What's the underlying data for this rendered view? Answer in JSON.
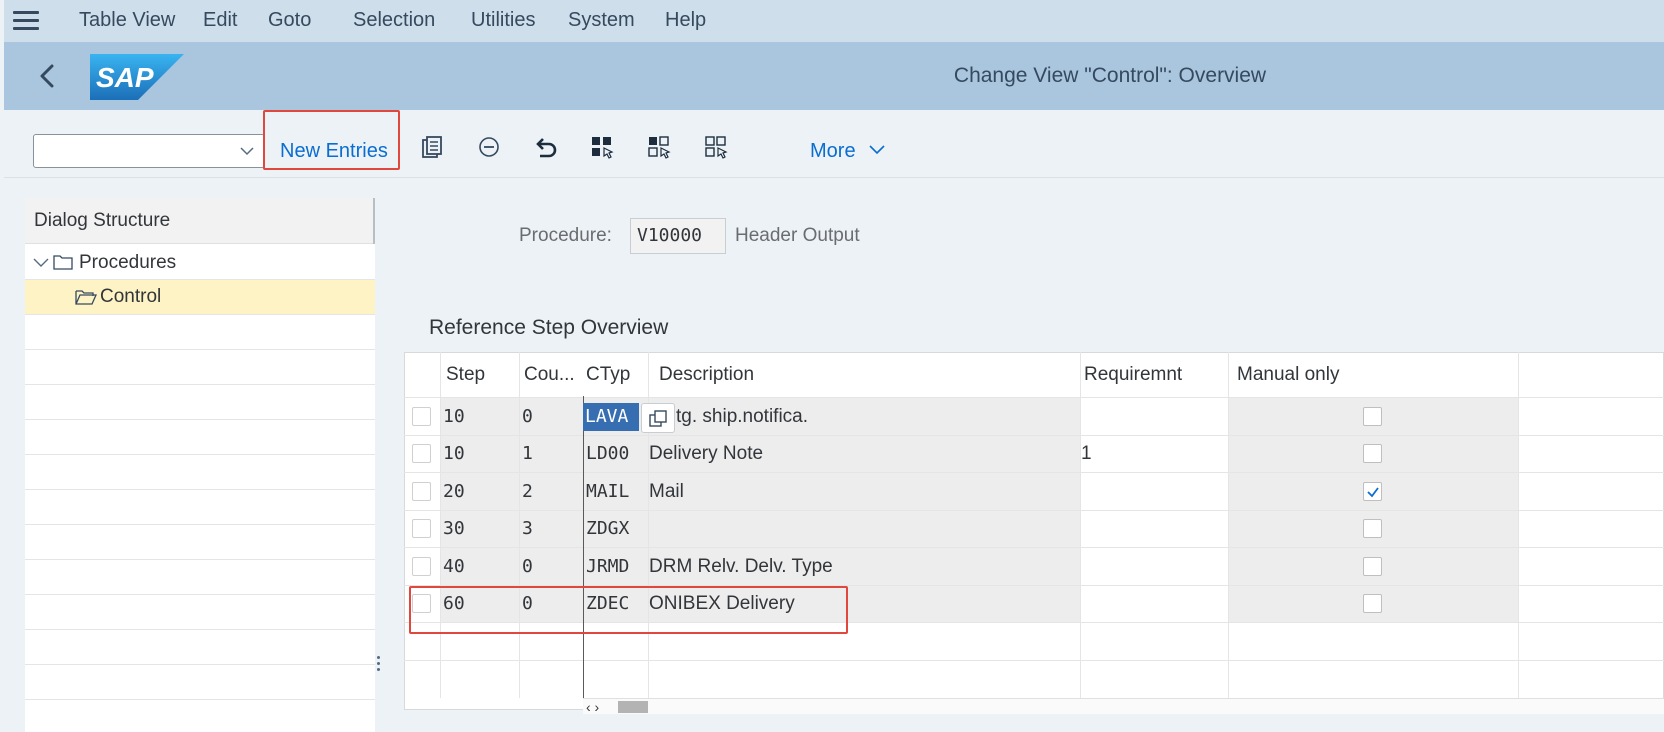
{
  "menu": {
    "items": [
      "Table View",
      "Edit",
      "Goto",
      "Selection",
      "Utilities",
      "System",
      "Help"
    ]
  },
  "header": {
    "title": "Change View \"Control\": Overview",
    "logo_text": "SAP"
  },
  "toolbar": {
    "select_value": "",
    "new_entries_label": "New Entries",
    "more_label": "More"
  },
  "dialog_structure": {
    "title": "Dialog Structure",
    "items": [
      {
        "label": "Procedures",
        "expanded": true,
        "icon": "folder-icon"
      },
      {
        "label": "Control",
        "selected": true,
        "icon": "folder-open-icon"
      }
    ]
  },
  "procedure": {
    "label": "Procedure:",
    "value": "V10000",
    "description": "Header Output"
  },
  "table": {
    "title": "Reference Step Overview",
    "columns": [
      "Step",
      "Cou...",
      "CTyp",
      "Description",
      "Requiremnt",
      "Manual only"
    ],
    "rows": [
      {
        "step": "10",
        "counter": "0",
        "ctyp": "LAVA",
        "description": "tg. ship.notifica.",
        "requirement": "",
        "manual_only": false
      },
      {
        "step": "10",
        "counter": "1",
        "ctyp": "LD00",
        "description": "Delivery Note",
        "requirement": "1",
        "manual_only": false
      },
      {
        "step": "20",
        "counter": "2",
        "ctyp": "MAIL",
        "description": "Mail",
        "requirement": "",
        "manual_only": true
      },
      {
        "step": "30",
        "counter": "3",
        "ctyp": "ZDGX",
        "description": "",
        "requirement": "",
        "manual_only": false
      },
      {
        "step": "40",
        "counter": "0",
        "ctyp": "JRMD",
        "description": "DRM Relv. Delv. Type",
        "requirement": "",
        "manual_only": false
      },
      {
        "step": "60",
        "counter": "0",
        "ctyp": "ZDEC",
        "description": "ONIBEX Delivery",
        "requirement": "",
        "manual_only": false
      }
    ],
    "scroll_arrows": "‹ ›"
  },
  "colors": {
    "menubar_bg": "#cfdeeb",
    "header_bg": "#a9c6de",
    "accent": "#0a6ed1",
    "highlight_box": "#e0483e",
    "selected_tree_row": "#fdf3c4"
  }
}
